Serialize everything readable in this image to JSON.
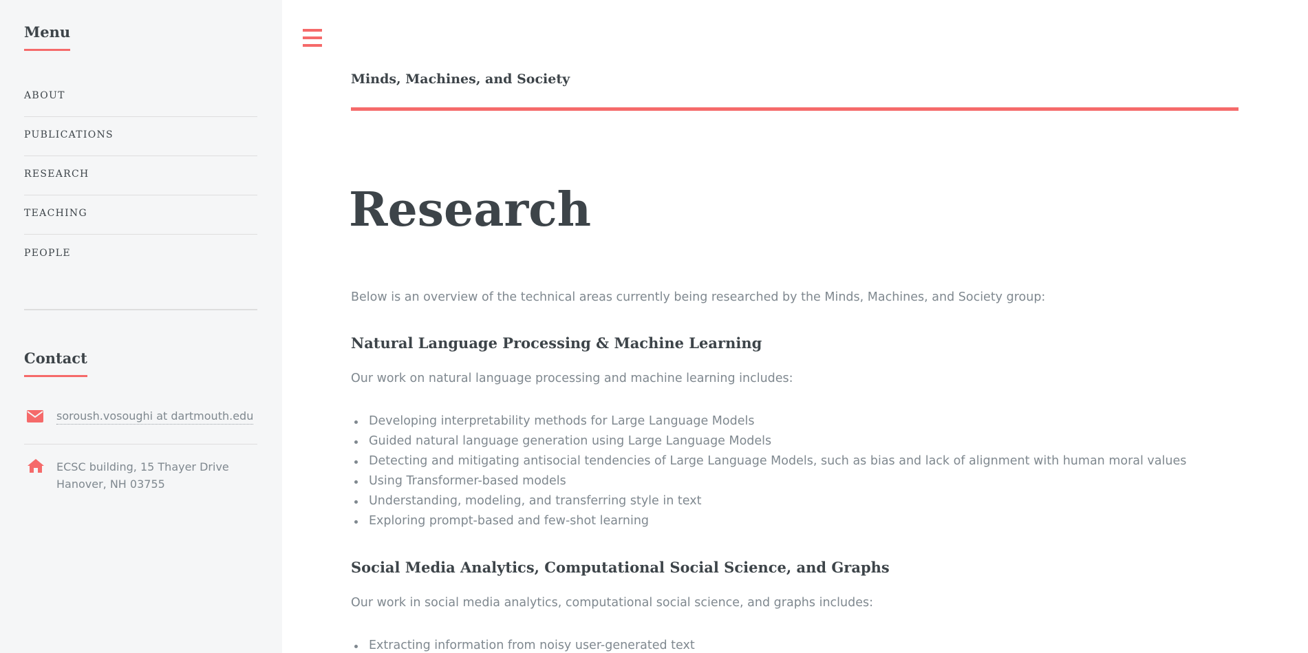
{
  "sidebar": {
    "menu_heading": "Menu",
    "nav_items": [
      {
        "label": "ABOUT"
      },
      {
        "label": "PUBLICATIONS"
      },
      {
        "label": "RESEARCH"
      },
      {
        "label": "TEACHING"
      },
      {
        "label": "PEOPLE"
      }
    ],
    "contact_heading": "Contact",
    "email": "soroush.vosoughi at dartmouth.edu",
    "address_line1": "ECSC building, 15 Thayer Drive",
    "address_line2": "Hanover, NH 03755",
    "email_icon": "envelope-icon",
    "address_icon": "home-icon"
  },
  "header": {
    "site_title": "Minds, Machines, and Society",
    "menu_icon": "hamburger-menu-icon"
  },
  "main": {
    "title": "Research",
    "intro": "Below is an overview of the technical areas currently being researched by the Minds, Machines, and Society group:",
    "sections": [
      {
        "heading": "Natural Language Processing & Machine Learning",
        "lead": "Our work on natural language processing and machine learning includes:",
        "items": [
          "Developing interpretability methods for Large Language Models",
          "Guided natural language generation using Large Language Models",
          "Detecting and mitigating antisocial tendencies of Large Language Models, such as bias and lack of alignment with human moral values",
          "Using Transformer-based models",
          "Understanding, modeling, and transferring style in text",
          "Exploring prompt-based and few-shot learning"
        ]
      },
      {
        "heading": "Social Media Analytics, Computational Social Science, and Graphs",
        "lead": "Our work in social media analytics, computational social science, and graphs includes:",
        "items": [
          "Extracting information from noisy user-generated text"
        ]
      }
    ]
  },
  "colors": {
    "accent": "#f56a6a",
    "heading": "#3d4449",
    "body_text": "#7f888f",
    "sidebar_bg": "#f5f6f7"
  }
}
